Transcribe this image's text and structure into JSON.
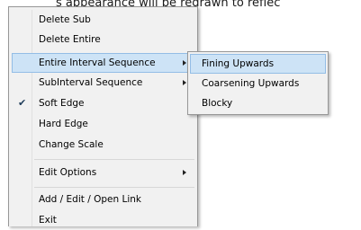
{
  "background_caption": "s appearance will be redrawn to reflec",
  "main_menu": {
    "items": [
      {
        "label": "Delete Sub"
      },
      {
        "label": "Delete Entire"
      },
      {
        "label": "Entire Interval Sequence",
        "has_submenu": true,
        "highlighted": true
      },
      {
        "label": "SubInterval Sequence",
        "has_submenu": true
      },
      {
        "label": "Soft Edge",
        "checked": true
      },
      {
        "label": "Hard Edge"
      },
      {
        "label": "Change Scale"
      },
      {
        "label": "Edit Options",
        "has_submenu": true
      },
      {
        "label": "Add / Edit / Open Link"
      },
      {
        "label": "Exit"
      }
    ]
  },
  "submenu": {
    "items": [
      {
        "label": "Fining Upwards",
        "highlighted": true
      },
      {
        "label": "Coarsening Upwards"
      },
      {
        "label": "Blocky"
      }
    ]
  },
  "colors": {
    "menu_bg": "#f1f1f1",
    "highlight_bg": "#cde3f6",
    "highlight_border": "#93bde6",
    "separator": "#d7d7d7"
  },
  "icons": {
    "check": "check-icon",
    "submenu_arrow": "chevron-right-icon"
  }
}
